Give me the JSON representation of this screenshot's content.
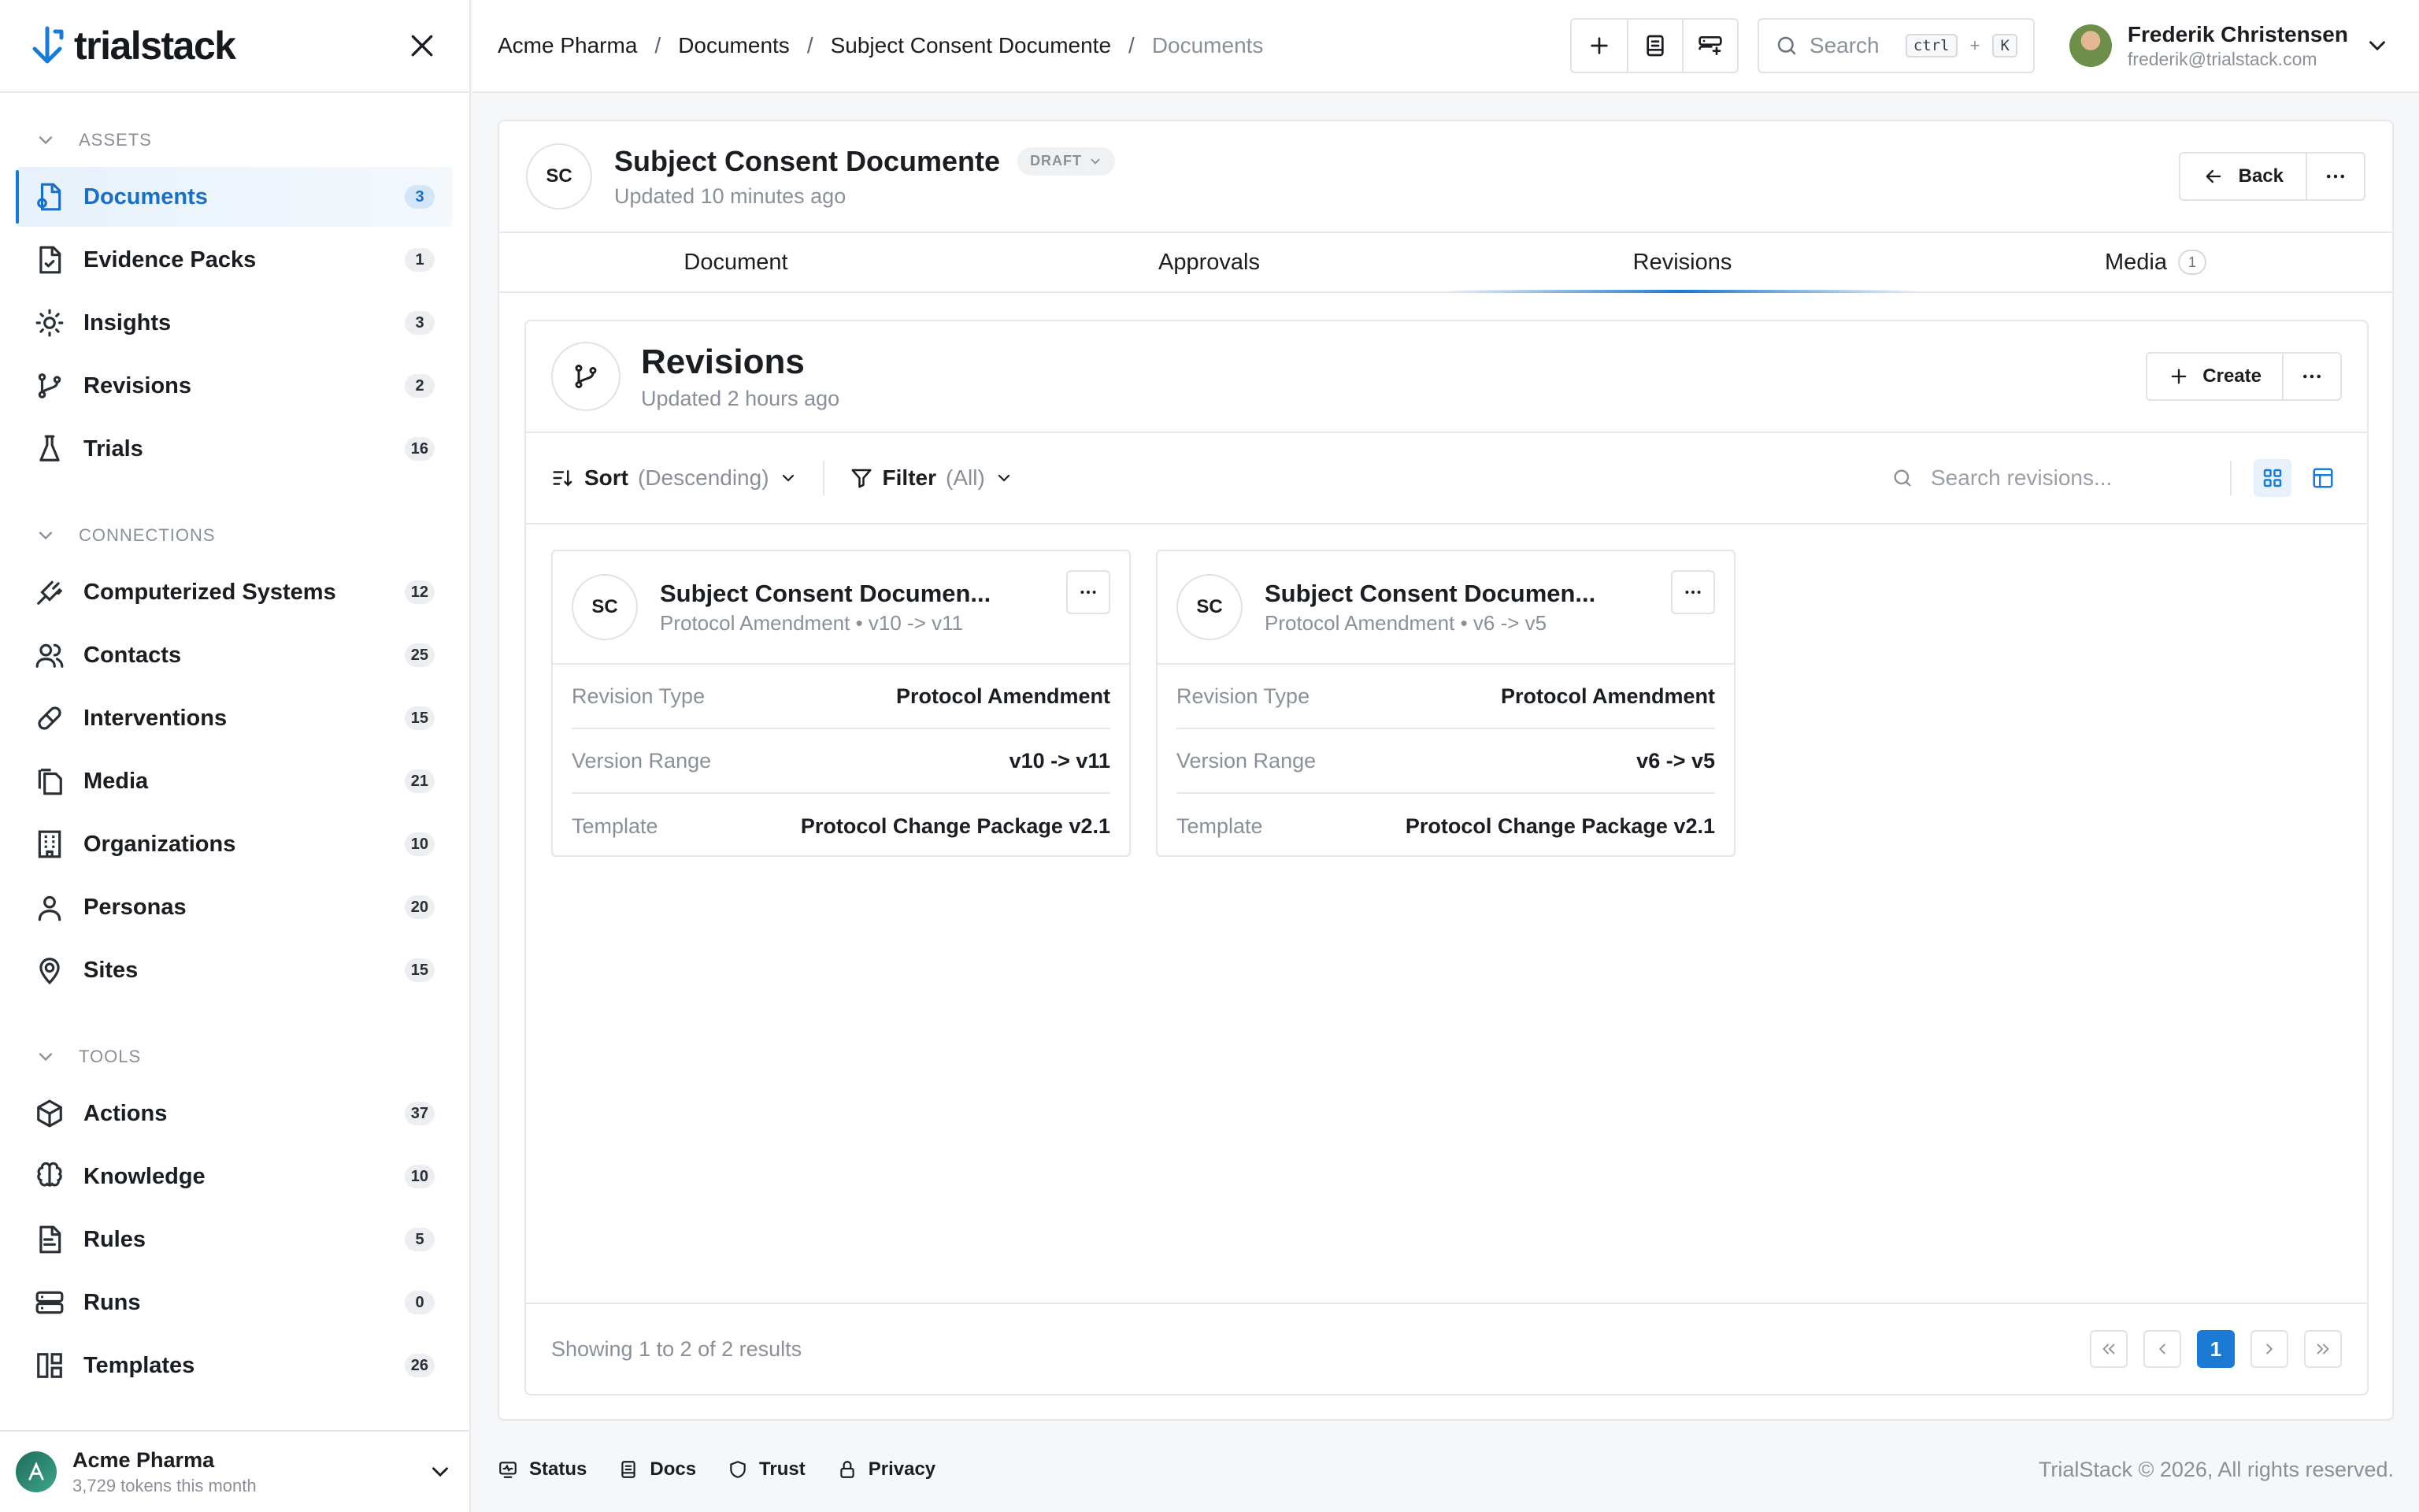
{
  "app": {
    "name": "trialstack",
    "accent": "#1b7bd4"
  },
  "sidebar": {
    "sections": [
      {
        "title": "ASSETS",
        "items": [
          {
            "label": "Documents",
            "count": "3",
            "icon": "document-icon",
            "active": true
          },
          {
            "label": "Evidence Packs",
            "count": "1",
            "icon": "file-check-icon"
          },
          {
            "label": "Insights",
            "count": "3",
            "icon": "lightbulb-icon"
          },
          {
            "label": "Revisions",
            "count": "2",
            "icon": "git-branch-icon"
          },
          {
            "label": "Trials",
            "count": "16",
            "icon": "flask-icon"
          }
        ]
      },
      {
        "title": "CONNECTIONS",
        "items": [
          {
            "label": "Computerized Systems",
            "count": "12",
            "icon": "plug-icon"
          },
          {
            "label": "Contacts",
            "count": "25",
            "icon": "users-icon"
          },
          {
            "label": "Interventions",
            "count": "15",
            "icon": "pill-icon"
          },
          {
            "label": "Media",
            "count": "21",
            "icon": "files-icon"
          },
          {
            "label": "Organizations",
            "count": "10",
            "icon": "building-icon"
          },
          {
            "label": "Personas",
            "count": "20",
            "icon": "user-icon"
          },
          {
            "label": "Sites",
            "count": "15",
            "icon": "map-pin-icon"
          }
        ]
      },
      {
        "title": "TOOLS",
        "items": [
          {
            "label": "Actions",
            "count": "37",
            "icon": "box-icon"
          },
          {
            "label": "Knowledge",
            "count": "10",
            "icon": "brain-icon"
          },
          {
            "label": "Rules",
            "count": "5",
            "icon": "rules-file-icon"
          },
          {
            "label": "Runs",
            "count": "0",
            "icon": "server-icon"
          },
          {
            "label": "Templates",
            "count": "26",
            "icon": "template-icon"
          }
        ]
      }
    ],
    "footer": {
      "org": "Acme Pharma",
      "usage": "3,729 tokens this month"
    }
  },
  "topbar": {
    "breadcrumbs": [
      "Acme Pharma",
      "Documents",
      "Subject Consent Documente",
      "Documents"
    ],
    "search": {
      "placeholder": "Search",
      "key1": "ctrl",
      "plus": "+",
      "key2": "K"
    },
    "user": {
      "name": "Frederik Christensen",
      "email": "frederik@trialstack.com"
    }
  },
  "document": {
    "initials": "SC",
    "title": "Subject Consent Documente",
    "status": "DRAFT",
    "updated": "Updated 10 minutes ago",
    "back_label": "Back",
    "tabs": [
      {
        "label": "Document"
      },
      {
        "label": "Approvals"
      },
      {
        "label": "Revisions",
        "active": true
      },
      {
        "label": "Media",
        "count": "1"
      }
    ]
  },
  "revisions": {
    "title": "Revisions",
    "updated": "Updated 2 hours ago",
    "create_label": "Create",
    "sort": {
      "label": "Sort",
      "value": "(Descending)"
    },
    "filter": {
      "label": "Filter",
      "value": "(All)"
    },
    "search_placeholder": "Search revisions...",
    "cards": [
      {
        "initials": "SC",
        "title": "Subject Consent Documen...",
        "subtitle": "Protocol Amendment • v10 -> v11",
        "fields": [
          {
            "key": "Revision Type",
            "value": "Protocol Amendment"
          },
          {
            "key": "Version Range",
            "value": "v10 -> v11"
          },
          {
            "key": "Template",
            "value": "Protocol Change Package v2.1"
          }
        ]
      },
      {
        "initials": "SC",
        "title": "Subject Consent Documen...",
        "subtitle": "Protocol Amendment • v6 -> v5",
        "fields": [
          {
            "key": "Revision Type",
            "value": "Protocol Amendment"
          },
          {
            "key": "Version Range",
            "value": "v6 -> v5"
          },
          {
            "key": "Template",
            "value": "Protocol Change Package v2.1"
          }
        ]
      }
    ],
    "pagination": {
      "summary": "Showing 1 to 2 of 2 results",
      "current_page": "1"
    }
  },
  "footer": {
    "links": [
      {
        "label": "Status",
        "icon": "status-icon"
      },
      {
        "label": "Docs",
        "icon": "book-icon"
      },
      {
        "label": "Trust",
        "icon": "shield-icon"
      },
      {
        "label": "Privacy",
        "icon": "lock-icon"
      }
    ],
    "copyright": "TrialStack © 2026, All rights reserved."
  }
}
